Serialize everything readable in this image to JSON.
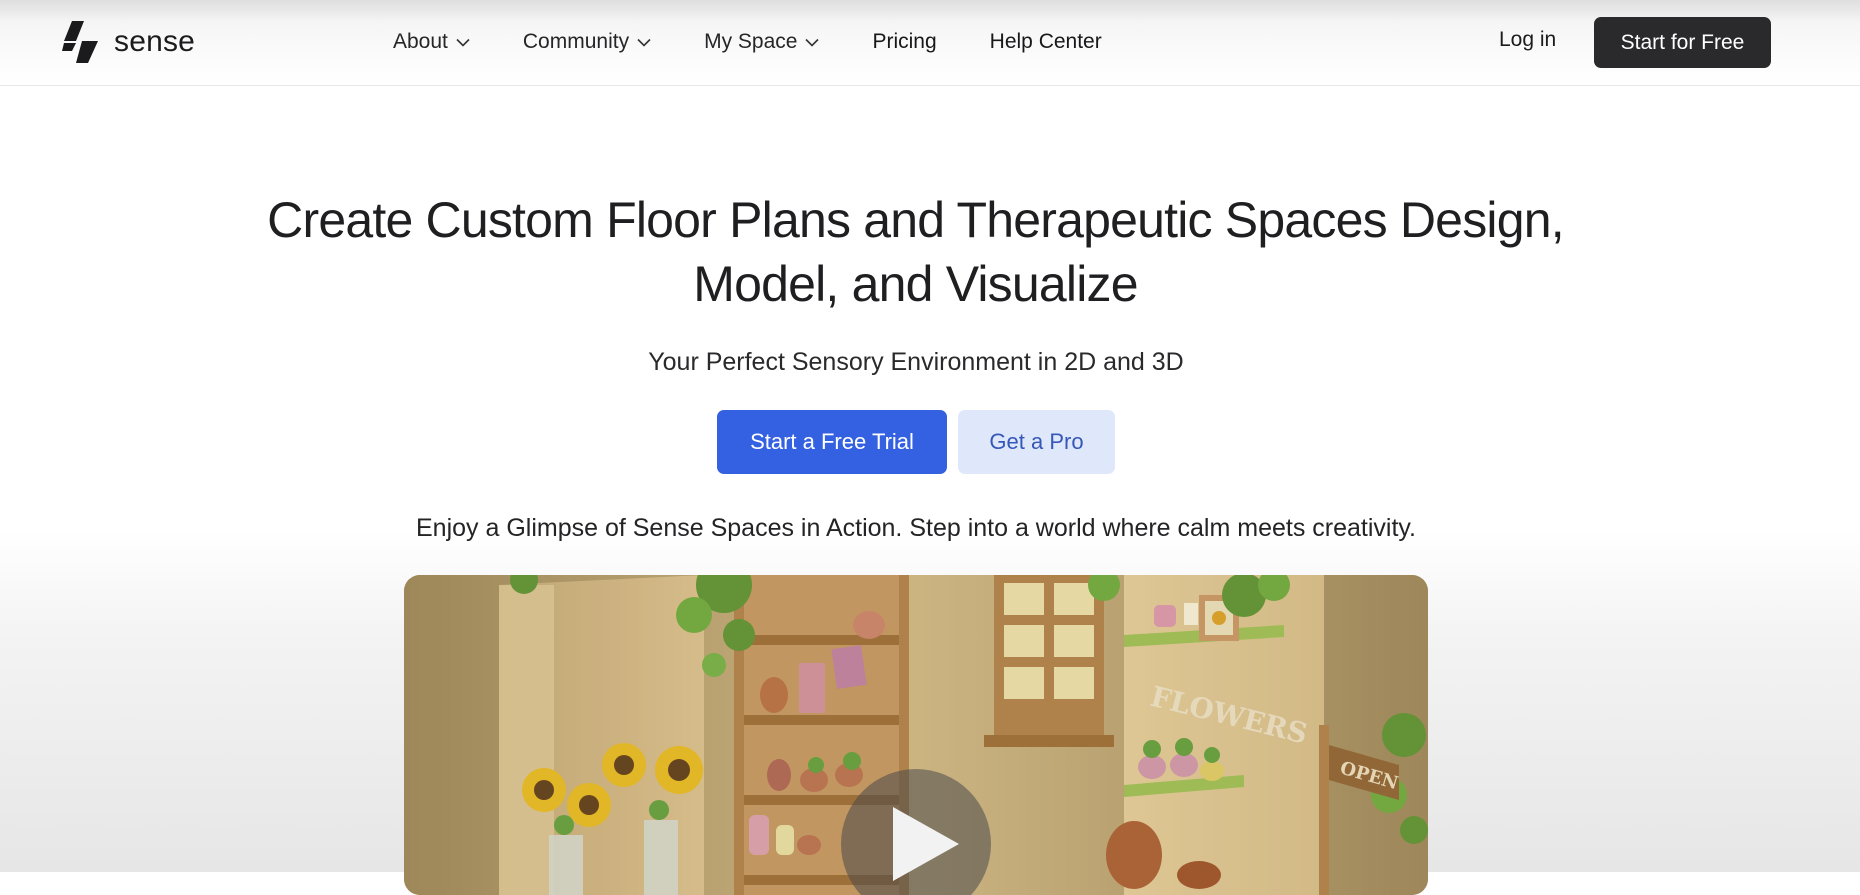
{
  "brand": {
    "name": "sense"
  },
  "nav": {
    "items": [
      {
        "label": "About",
        "dropdown": true
      },
      {
        "label": "Community",
        "dropdown": true
      },
      {
        "label": "My Space",
        "dropdown": true
      },
      {
        "label": "Pricing",
        "dropdown": false
      },
      {
        "label": "Help Center",
        "dropdown": false
      }
    ],
    "login_label": "Log in",
    "cta_label": "Start for Free"
  },
  "hero": {
    "title_line1": "Create Custom Floor Plans and Therapeutic Spaces Design,",
    "title_line2": "Model, and Visualize",
    "subtitle": "Your Perfect Sensory Environment in 2D and 3D",
    "primary_button": "Start a Free Trial",
    "secondary_button": "Get a Pro",
    "glimpse_text": "Enjoy a Glimpse of Sense Spaces in Action. Step into a world where calm meets creativity."
  },
  "video": {
    "wall_sign": "FLOWERS",
    "shop_sign": "OPEN",
    "play_icon": "play-icon"
  },
  "colors": {
    "primary": "#3461e1",
    "secondary_bg": "#dfe8fb",
    "dark": "#2a2a2c"
  }
}
